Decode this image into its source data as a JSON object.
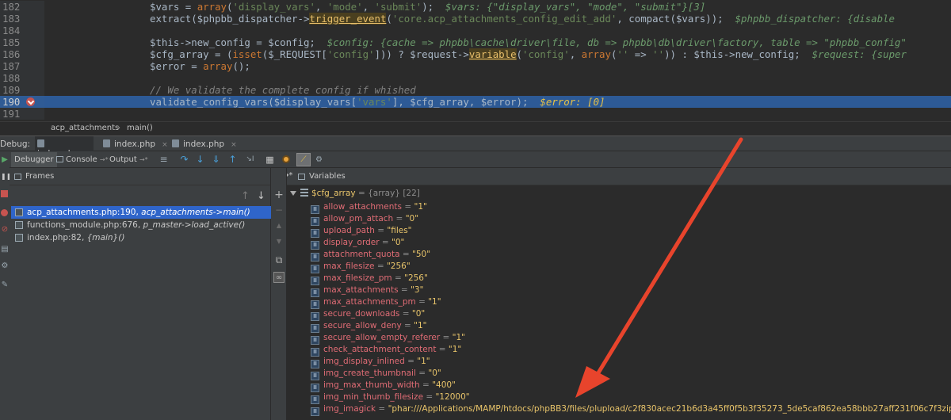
{
  "editor": {
    "lines": [
      {
        "num": "182",
        "segments": [
          {
            "t": "$vars = ",
            "c": "ident"
          },
          {
            "t": "array",
            "c": "kw"
          },
          {
            "t": "(",
            "c": "ident"
          },
          {
            "t": "'display_vars'",
            "c": "str"
          },
          {
            "t": ", ",
            "c": "ident"
          },
          {
            "t": "'mode'",
            "c": "str"
          },
          {
            "t": ", ",
            "c": "ident"
          },
          {
            "t": "'submit'",
            "c": "str"
          },
          {
            "t": ");  ",
            "c": "ident"
          },
          {
            "t": "$vars: {\"display_vars\", \"mode\", \"submit\"}[3]",
            "c": "inline"
          }
        ]
      },
      {
        "num": "183",
        "segments": [
          {
            "t": "extract($phpbb_dispatcher->",
            "c": "ident"
          },
          {
            "t": "trigger_event",
            "c": "fn-hl"
          },
          {
            "t": "(",
            "c": "ident"
          },
          {
            "t": "'core.acp_attachments_config_edit_add'",
            "c": "str"
          },
          {
            "t": ", compact($vars));  ",
            "c": "ident"
          },
          {
            "t": "$phpbb_dispatcher: {disable",
            "c": "inline"
          }
        ]
      },
      {
        "num": "184",
        "segments": []
      },
      {
        "num": "185",
        "segments": [
          {
            "t": "$this->new_config = $config;  ",
            "c": "ident"
          },
          {
            "t": "$config: {cache => phpbb\\cache\\driver\\file, db => phpbb\\db\\driver\\factory, table => \"phpbb_config\"",
            "c": "inline"
          }
        ]
      },
      {
        "num": "186",
        "segments": [
          {
            "t": "$cfg_array = (",
            "c": "ident"
          },
          {
            "t": "isset",
            "c": "kw"
          },
          {
            "t": "($_REQUEST[",
            "c": "ident"
          },
          {
            "t": "'config'",
            "c": "str"
          },
          {
            "t": "])) ? $request->",
            "c": "ident"
          },
          {
            "t": "variable",
            "c": "fn-hl"
          },
          {
            "t": "(",
            "c": "ident"
          },
          {
            "t": "'config'",
            "c": "str"
          },
          {
            "t": ", ",
            "c": "ident"
          },
          {
            "t": "array",
            "c": "kw"
          },
          {
            "t": "(",
            "c": "ident"
          },
          {
            "t": "''",
            "c": "str"
          },
          {
            "t": " => ",
            "c": "ident"
          },
          {
            "t": "''",
            "c": "str"
          },
          {
            "t": ")) : $this->new_config;  ",
            "c": "ident"
          },
          {
            "t": "$request: {super",
            "c": "inline"
          }
        ]
      },
      {
        "num": "187",
        "segments": [
          {
            "t": "$error = ",
            "c": "ident"
          },
          {
            "t": "array",
            "c": "kw"
          },
          {
            "t": "();",
            "c": "ident"
          }
        ]
      },
      {
        "num": "188",
        "segments": []
      },
      {
        "num": "189",
        "segments": [
          {
            "t": "// We validate the complete config if whished",
            "c": "comment"
          }
        ]
      },
      {
        "num": "190",
        "highlight": true,
        "segments": [
          {
            "t": "validate_config_vars($display_vars[",
            "c": "ident"
          },
          {
            "t": "'vars'",
            "c": "str"
          },
          {
            "t": "], $cfg_array, $error);  ",
            "c": "ident"
          },
          {
            "t": "$error: [0]",
            "c": "inline"
          }
        ]
      },
      {
        "num": "191",
        "segments": []
      }
    ]
  },
  "breadcrumb": {
    "file": "acp_attachments",
    "sep": "›",
    "method": "main()"
  },
  "debug_tabs": {
    "label": "Debug:",
    "tabs": [
      {
        "label": "index.php"
      },
      {
        "label": "index.php"
      },
      {
        "label": "index.php"
      }
    ],
    "close": "×"
  },
  "toolbar": {
    "debugger": "Debugger",
    "console": "Console",
    "console_suffix": "→*",
    "output": "Output",
    "output_suffix": "→*"
  },
  "frames": {
    "title": "Frames",
    "items": [
      {
        "loc": "acp_attachments.php:190, ",
        "method": "acp_attachments->main()",
        "selected": true
      },
      {
        "loc": "functions_module.php:676, ",
        "method": "p_master->load_active()"
      },
      {
        "loc": "index.php:82, ",
        "method": "{main}()"
      }
    ]
  },
  "variables": {
    "title": "Variables",
    "root": {
      "name": "$cfg_array",
      "meta": " = {array} [22]"
    },
    "items": [
      {
        "name": "allow_attachments",
        "value": "\"1\""
      },
      {
        "name": "allow_pm_attach",
        "value": "\"0\""
      },
      {
        "name": "upload_path",
        "value": "\"files\""
      },
      {
        "name": "display_order",
        "value": "\"0\""
      },
      {
        "name": "attachment_quota",
        "value": "\"50\""
      },
      {
        "name": "max_filesize",
        "value": "\"256\""
      },
      {
        "name": "max_filesize_pm",
        "value": "\"256\""
      },
      {
        "name": "max_attachments",
        "value": "\"3\""
      },
      {
        "name": "max_attachments_pm",
        "value": "\"1\""
      },
      {
        "name": "secure_downloads",
        "value": "\"0\""
      },
      {
        "name": "secure_allow_deny",
        "value": "\"1\""
      },
      {
        "name": "secure_allow_empty_referer",
        "value": "\"1\""
      },
      {
        "name": "check_attachment_content",
        "value": "\"1\""
      },
      {
        "name": "img_display_inlined",
        "value": "\"1\""
      },
      {
        "name": "img_create_thumbnail",
        "value": "\"0\""
      },
      {
        "name": "img_max_thumb_width",
        "value": "\"400\""
      },
      {
        "name": "img_min_thumb_filesize",
        "value": "\"12000\""
      },
      {
        "name": "img_imagick",
        "value": "\"phar:///Applications/MAMP/htdocs/phpBB3/files/plupload/c2f830acec21b6d3a45ff0f5b3f35273_5de5caf862ea58bbb27aff231f06c7f3zip.part/\""
      }
    ]
  },
  "colors": {
    "highlight_line": "#2d5a96",
    "selection": "#2f65ca",
    "arrow": "#e8442c"
  }
}
